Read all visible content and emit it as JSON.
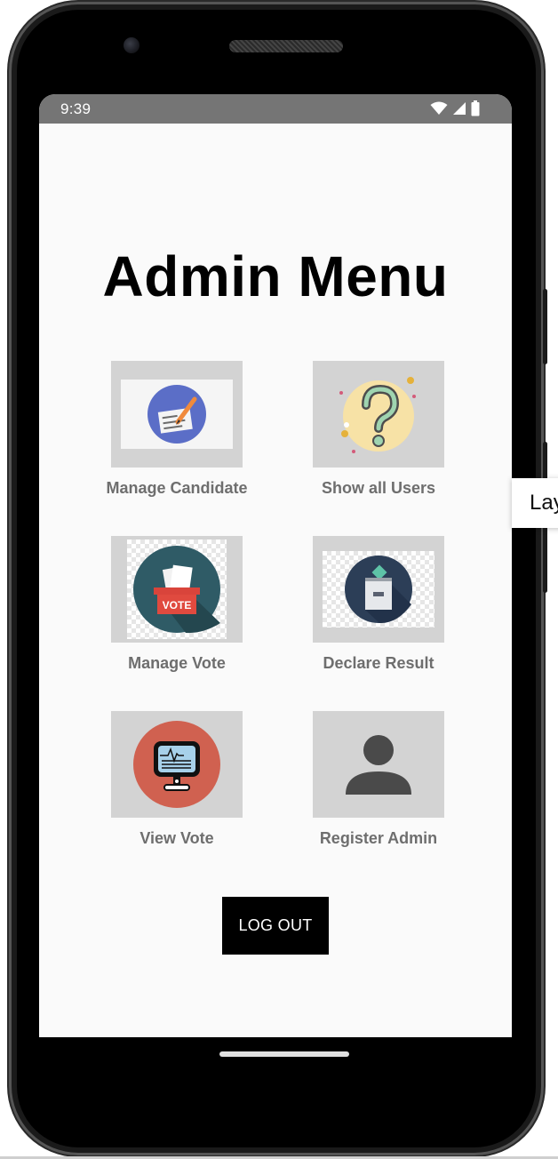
{
  "status_bar": {
    "time": "9:39"
  },
  "title": "Admin Menu",
  "menu_items": [
    {
      "label": "Manage Candidate",
      "icon": "edit-document-icon"
    },
    {
      "label": "Show all Users",
      "icon": "question-mark-icon"
    },
    {
      "label": "Manage Vote",
      "icon": "ballot-box-vote-icon"
    },
    {
      "label": "Declare Result",
      "icon": "ballot-box-icon"
    },
    {
      "label": "View Vote",
      "icon": "monitor-icon"
    },
    {
      "label": "Register Admin",
      "icon": "person-icon"
    }
  ],
  "logout_label": "LOG OUT",
  "tooltip_text": "Layout",
  "colors": {
    "tile_bg": "#d3d3d3",
    "label_text": "#6e6e6e",
    "status_bar": "#757575",
    "logout_bg": "#000000"
  }
}
